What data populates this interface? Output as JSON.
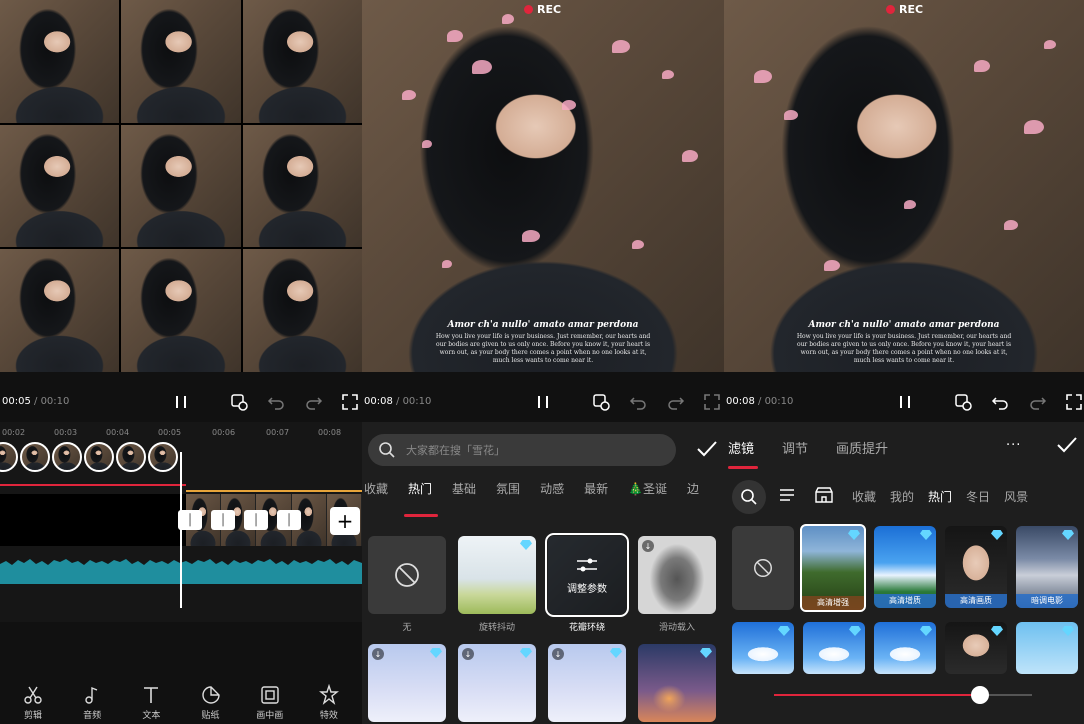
{
  "panel1": {
    "time_current": "00:05",
    "time_total": "/ 00:10",
    "ruler": [
      "00:02",
      "00:03",
      "00:04",
      "00:05",
      "00:06",
      "00:07",
      "00:08"
    ],
    "tools": [
      {
        "icon": "scissors-icon",
        "label": "剪辑"
      },
      {
        "icon": "music-note-icon",
        "label": "音频"
      },
      {
        "icon": "text-icon",
        "label": "文本"
      },
      {
        "icon": "sticker-icon",
        "label": "贴纸"
      },
      {
        "icon": "picture-in-picture-icon",
        "label": "画中画"
      },
      {
        "icon": "effects-icon",
        "label": "特效"
      }
    ]
  },
  "panel2": {
    "rec": "REC",
    "caption_title": "Amor ch'a nullo' amato amar perdona",
    "caption_body": "How you live your life is your business. Just remember, our hearts and our bodies are given to us only once. Before you know it, your heart is worn out, as your body there comes a point when no one looks at it, much less wants to come near it.",
    "time_current": "00:08",
    "time_total": "/ 00:10",
    "search_placeholder": "大家都在搜「雪花」",
    "tabs": [
      "收藏",
      "热门",
      "基础",
      "氛围",
      "动感",
      "最新",
      "🎄圣诞",
      "边"
    ],
    "active_tab": 1,
    "cards": [
      {
        "label": "无",
        "kind": "none"
      },
      {
        "label": "旋转抖动",
        "kind": "snow"
      },
      {
        "label": "花瓣环绕",
        "kind": "adjust",
        "adjust_label": "调整参数"
      },
      {
        "label": "滑动载入",
        "kind": "blur"
      }
    ]
  },
  "panel3": {
    "rec": "REC",
    "caption_title": "Amor ch'a nullo' amato amar perdona",
    "caption_body": "How you live your life is your business. Just remember, our hearts and our bodies are given to us only once. Before you know it, your heart is worn out, as your body there comes a point when no one looks at it, much less wants to come near it.",
    "time_current": "00:08",
    "time_total": "/ 00:10",
    "top_tabs": [
      "滤镜",
      "调节",
      "画质提升"
    ],
    "more": "···",
    "categories": [
      "收藏",
      "我的",
      "热门",
      "冬日",
      "风景"
    ],
    "active_category": 2,
    "filters": [
      {
        "name": "高清增强",
        "kind": "forest"
      },
      {
        "name": "高清增质",
        "kind": "sky"
      },
      {
        "name": "高清画质",
        "kind": "face"
      },
      {
        "name": "暗调电影",
        "kind": "lake"
      }
    ],
    "slider_value": 0.8
  },
  "colors": {
    "accent": "#e0253c",
    "orange": "#e7a43a",
    "gem": "#64d6ff",
    "wave": "#1f8e9e"
  }
}
